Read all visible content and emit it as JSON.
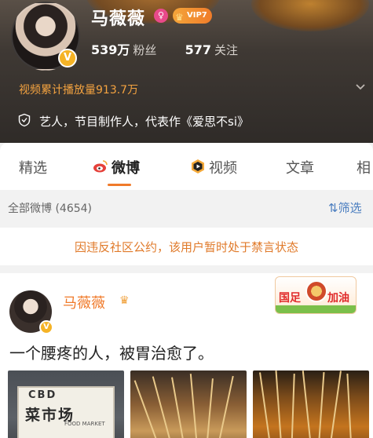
{
  "profile": {
    "name": "马薇薇",
    "vip_label": "VIP7",
    "followers": "539万",
    "followers_label": "粉丝",
    "following": "577",
    "following_label": "关注",
    "video_play_count": "视频累计播放量913.7万",
    "bio": "艺人，节目制作人，代表作《爱思不si》",
    "verified_badge": "V"
  },
  "tabs": [
    {
      "label": "精选",
      "active": false
    },
    {
      "label": "微博",
      "active": true,
      "icon": "weibo-icon"
    },
    {
      "label": "视频",
      "active": false,
      "icon": "video-play-icon"
    },
    {
      "label": "文章",
      "active": false
    },
    {
      "label": "相",
      "active": false
    }
  ],
  "filter": {
    "count_label": "全部微博 (4654)",
    "filter_button": "筛选"
  },
  "notice": {
    "text": "因违反社区公约，该用户暂时处于禁言状态"
  },
  "post": {
    "author": "马薇薇",
    "verified_badge": "V",
    "sticker_left": "国足",
    "sticker_right": "加油",
    "text": "一个腰疼的人，被胃治愈了。",
    "photos": [
      {
        "sign_top": "CBD",
        "sign_main": "菜市场",
        "sign_sub": "FOOD  MARKET"
      },
      {
        "description": ""
      },
      {
        "description": ""
      }
    ]
  },
  "colors": {
    "accent": "#f07a2a",
    "link_blue": "#4a7dbf",
    "notice_orange": "#e07a2a",
    "play_count": "#f4a340"
  }
}
